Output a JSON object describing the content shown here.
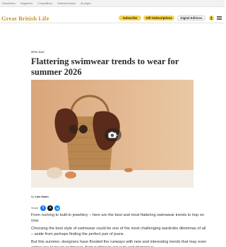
{
  "topnav": {
    "items": [
      "Newsletters",
      "Magazines",
      "Competitions",
      "National Awards",
      "All pages"
    ]
  },
  "header": {
    "logo": "Great British Life",
    "subscribe_label": "Subscribe",
    "gift_label": "Gift Subscriptions",
    "digital_label": "Digital Editions"
  },
  "article": {
    "date": "29TH JULY",
    "title": "Flattering swimwear trends to wear for summer 2026",
    "byline_prefix": "By",
    "author": "Lois Owen",
    "share_label": "Share",
    "paragraphs": [
      "From ruching to built-in jewellery – here are the best and most flattering swimwear trends to hop on now.",
      "Choosing the best style of swimwear could be one of the most challenging wardrobe dilemmas of all – aside from perhaps finding the perfect pair of jeans.",
      "But this summer, designers have flooded the runways with new and interesting trends that may even entice you to try on swimwear, from ruching to cut-outs and glamorous"
    ]
  },
  "colors": {
    "accent": "#f7d44c",
    "logo": "#c8932e",
    "hero_background": "#e2b88e"
  }
}
